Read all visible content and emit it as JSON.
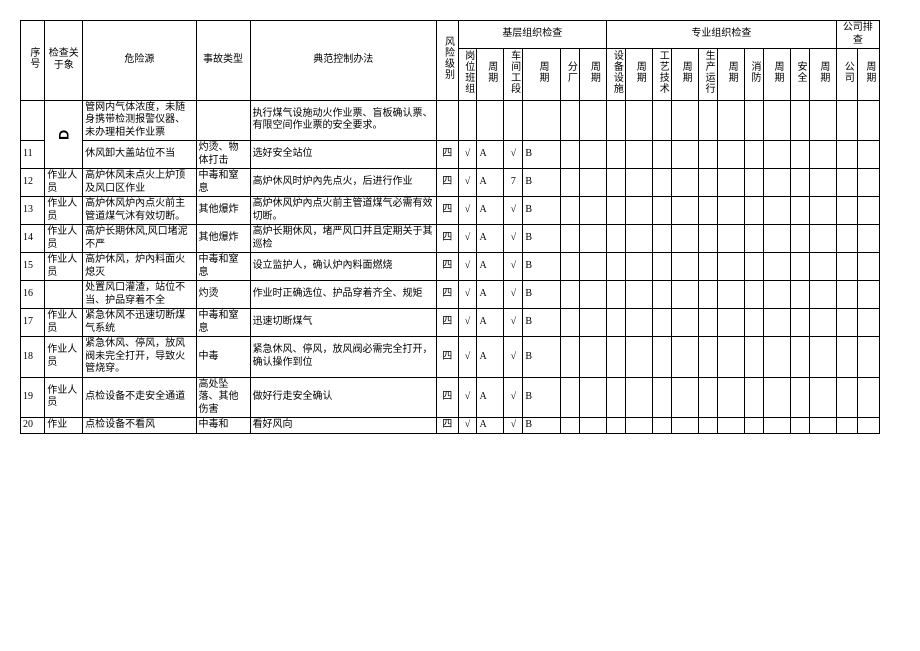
{
  "headers": {
    "seq": "序号",
    "obj": "检查关于象",
    "src": "危险源",
    "type": "事故类型",
    "meas": "典范控制办法",
    "risk": "风险级别",
    "grassroots": "基层组织检查",
    "professional": "专业组织检查",
    "company": "公司排查",
    "g_post": "岗位班组",
    "g_cycle": "周期",
    "g_section": "车间工段",
    "g_branch": "分厂",
    "p_equip": "设备设施",
    "p_tech": "工艺技术",
    "p_prod": "生产运行",
    "p_fire": "消防",
    "p_safe": "安全",
    "co_company": "公司"
  },
  "mark": "D",
  "row_pre": {
    "src": "管网内气体浓度，未随身携带检测报警仪器、未办理相关作业票",
    "meas": "执行煤气设施动火作业票、盲板确认票、有限空间作业票的安全要求。"
  },
  "rows": [
    {
      "seq": "11",
      "obj": "",
      "src": "休风卸大盖站位不当",
      "type": "灼烫、物体打击",
      "meas": "选好安全站位",
      "risk": "四",
      "b_post": "√",
      "b_cycle": "A",
      "b_sect": "√",
      "b_scycle": "B"
    },
    {
      "seq": "12",
      "obj": "作业人员",
      "src": "高炉休风未点火上炉顶及风口区作业",
      "type": "中毒和窒息",
      "meas": "高炉休风时炉內先点火，后进行作业",
      "risk": "四",
      "b_post": "√",
      "b_cycle": "A",
      "b_sect": "7",
      "b_scycle": "B"
    },
    {
      "seq": "13",
      "obj": "作业人员",
      "src": "高炉休风炉內点火前主管道煤气沐有效切断。",
      "type": "其他爆炸",
      "meas": "高炉休风炉內点火前主管道煤气必需有效切断。",
      "risk": "四",
      "b_post": "√",
      "b_cycle": "A",
      "b_sect": "√",
      "b_scycle": "B"
    },
    {
      "seq": "14",
      "obj": "作业人员",
      "src": "高炉长期休风,风口堵泥不严",
      "type": "其他爆炸",
      "meas": "高炉长期休风，堵严风口并且定期关于其巡检",
      "risk": "四",
      "b_post": "√",
      "b_cycle": "A",
      "b_sect": "√",
      "b_scycle": "B"
    },
    {
      "seq": "15",
      "obj": "作业人员",
      "src": "高炉休风，炉內料面火熄灭",
      "type": "中毒和窒息",
      "meas": "设立监护人，确认炉內料面燃烧",
      "risk": "四",
      "b_post": "√",
      "b_cycle": "A",
      "b_sect": "√",
      "b_scycle": "B"
    },
    {
      "seq": "16",
      "obj": "",
      "src": "处置风口灌渣，站位不当、护品穿着不全",
      "type": "灼烫",
      "meas": "作业时正确选位、护品穿着齐全、规矩",
      "risk": "四",
      "b_post": "√",
      "b_cycle": "A",
      "b_sect": "√",
      "b_scycle": "B"
    },
    {
      "seq": "17",
      "obj": "作业人员",
      "src": "紧急休风不迅速切断煤气系统",
      "type": "中毒和窒息",
      "meas": "迅速切断煤气",
      "risk": "四",
      "b_post": "√",
      "b_cycle": "A",
      "b_sect": "√",
      "b_scycle": "B"
    },
    {
      "seq": "18",
      "obj": "作业人员",
      "src": "紧急休风、停风，放风阀未完全打开，导致火管烧穿。",
      "type": "中毒",
      "meas": "紧急休风、停风，放风阀必需完全打开，确认操作到位",
      "risk": "四",
      "b_post": "√",
      "b_cycle": "A",
      "b_sect": "√",
      "b_scycle": "B"
    },
    {
      "seq": "19",
      "obj": "作业人员",
      "src": "点检设备不走安全通道",
      "type": "高处坠落、其他伤害",
      "meas": "做好行走安全确认",
      "risk": "四",
      "b_post": "√",
      "b_cycle": "A",
      "b_sect": "√",
      "b_scycle": "B"
    },
    {
      "seq": "20",
      "obj": "作业",
      "src": "点检设备不看风",
      "type": "中毒和",
      "meas": "看好风向",
      "risk": "四",
      "b_post": "√",
      "b_cycle": "A",
      "b_sect": "√",
      "b_scycle": "B"
    }
  ]
}
